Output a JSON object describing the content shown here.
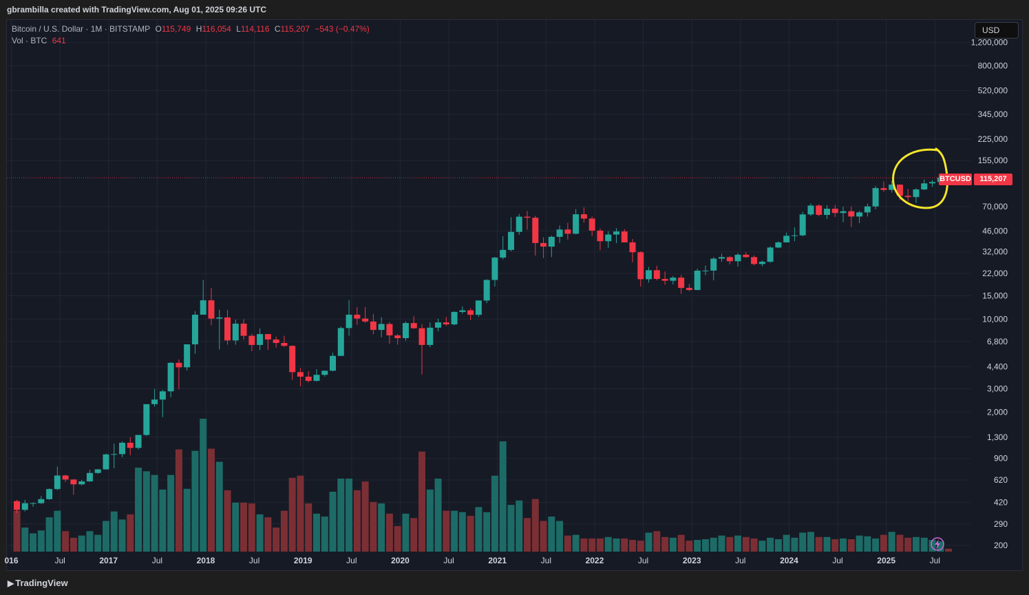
{
  "attribution": "gbrambilla created with TradingView.com, Aug 01, 2025 09:26 UTC",
  "legend": {
    "symbol": "Bitcoin / U.S. Dollar · 1M · BITSTAMP",
    "o_label": "O",
    "o_value": "115,749",
    "h_label": "H",
    "h_value": "116,054",
    "l_label": "L",
    "l_value": "114,116",
    "c_label": "C",
    "c_value": "115,207",
    "change": "−543 (−0.47%)",
    "vol_label": "Vol · BTC",
    "vol_value": "641"
  },
  "currency_button": "USD",
  "price_label": {
    "symbol": "BTCUSD",
    "value": "115,207"
  },
  "footer_brand": "TradingView",
  "colors": {
    "up": "#26a69a",
    "down": "#f23645",
    "vol_up": "#1d6b66",
    "vol_down": "#7b2f34",
    "annotation": "#f5e52a",
    "background": "#161a25"
  },
  "chart_data": {
    "type": "candlestick",
    "title": "Bitcoin / U.S. Dollar · 1M · BITSTAMP",
    "y_scale": "log",
    "y_ticks": [
      200,
      290,
      420,
      620,
      900,
      1300,
      2000,
      3000,
      4400,
      6800,
      10000,
      15000,
      22000,
      32000,
      46000,
      70000,
      155000,
      225000,
      345000,
      520000,
      800000,
      1200000
    ],
    "y_tick_labels": [
      "200",
      "290",
      "420",
      "620",
      "900",
      "1,300",
      "2,000",
      "3,000",
      "4,400",
      "6,800",
      "10,000",
      "15,000",
      "22,000",
      "32,000",
      "46,000",
      "70,000",
      "155,000",
      "225,000",
      "345,000",
      "520,000",
      "800,000",
      "1,200,000"
    ],
    "x_tick_labels": [
      "016",
      "Jul",
      "2017",
      "Jul",
      "2018",
      "Jul",
      "2019",
      "Jul",
      "2020",
      "Jul",
      "2021",
      "Jul",
      "2022",
      "Jul",
      "2023",
      "Jul",
      "2024",
      "Jul",
      "2025",
      "Jul"
    ],
    "x_tick_months": [
      0,
      6,
      12,
      18,
      24,
      30,
      36,
      42,
      48,
      54,
      60,
      66,
      72,
      78,
      84,
      90,
      96,
      102,
      108,
      114
    ],
    "first_month": "2016-01",
    "last_close_line": 115207,
    "candles": [
      [
        430,
        440,
        350,
        370
      ],
      [
        370,
        440,
        360,
        415
      ],
      [
        415,
        420,
        390,
        415
      ],
      [
        415,
        470,
        410,
        445
      ],
      [
        445,
        535,
        440,
        530
      ],
      [
        530,
        780,
        520,
        670
      ],
      [
        670,
        680,
        600,
        625
      ],
      [
        625,
        630,
        480,
        575
      ],
      [
        575,
        620,
        565,
        605
      ],
      [
        605,
        740,
        600,
        700
      ],
      [
        700,
        750,
        690,
        745
      ],
      [
        745,
        980,
        740,
        965
      ],
      [
        965,
        1160,
        760,
        970
      ],
      [
        970,
        1210,
        920,
        1180
      ],
      [
        1180,
        1300,
        950,
        1080
      ],
      [
        1080,
        1350,
        1050,
        1350
      ],
      [
        1350,
        2000,
        1330,
        2300
      ],
      [
        2300,
        2990,
        2200,
        2490
      ],
      [
        2490,
        2950,
        1840,
        2870
      ],
      [
        2870,
        4750,
        2600,
        4700
      ],
      [
        4700,
        4980,
        2980,
        4350
      ],
      [
        4350,
        6470,
        4120,
        6470
      ],
      [
        6470,
        11500,
        5500,
        10800
      ],
      [
        10800,
        19666,
        10800,
        13850
      ],
      [
        13850,
        17200,
        9000,
        10100
      ],
      [
        10100,
        11780,
        5920,
        10300
      ],
      [
        10300,
        11700,
        6425,
        6920
      ],
      [
        6920,
        9900,
        6430,
        9250
      ],
      [
        9250,
        10000,
        7010,
        7500
      ],
      [
        7500,
        7770,
        5750,
        6400
      ],
      [
        6400,
        8500,
        5860,
        7730
      ],
      [
        7730,
        7700,
        5880,
        7030
      ],
      [
        7030,
        7400,
        6100,
        6625
      ],
      [
        6625,
        7500,
        6200,
        6300
      ],
      [
        6300,
        6350,
        3500,
        4000
      ],
      [
        4000,
        4300,
        3130,
        3700
      ],
      [
        3700,
        4060,
        3350,
        3440
      ],
      [
        3440,
        4210,
        3400,
        3820
      ],
      [
        3820,
        4100,
        3700,
        4100
      ],
      [
        4100,
        5600,
        4050,
        5300
      ],
      [
        5300,
        8800,
        5300,
        8570
      ],
      [
        8570,
        13880,
        7500,
        10800
      ],
      [
        10800,
        12300,
        9070,
        10100
      ],
      [
        10100,
        12330,
        9350,
        9600
      ],
      [
        9600,
        10950,
        7700,
        8300
      ],
      [
        8300,
        10350,
        7300,
        9200
      ],
      [
        9200,
        9500,
        6550,
        7550
      ],
      [
        7550,
        7750,
        6430,
        7200
      ],
      [
        7200,
        9600,
        6900,
        9350
      ],
      [
        9350,
        10500,
        8450,
        8550
      ],
      [
        8550,
        9200,
        3850,
        6400
      ],
      [
        6400,
        9450,
        6150,
        8630
      ],
      [
        8630,
        10070,
        8100,
        9450
      ],
      [
        9450,
        10400,
        8900,
        9140
      ],
      [
        9140,
        11440,
        8970,
        11330
      ],
      [
        11330,
        12450,
        10970,
        11650
      ],
      [
        11650,
        12070,
        9830,
        10780
      ],
      [
        10780,
        13860,
        10380,
        13800
      ],
      [
        13800,
        19900,
        13200,
        19700
      ],
      [
        19700,
        29300,
        17600,
        28990
      ],
      [
        28990,
        41950,
        28100,
        33100
      ],
      [
        33100,
        58300,
        32300,
        45200
      ],
      [
        45200,
        61780,
        43000,
        58800
      ],
      [
        58800,
        64900,
        47000,
        57750
      ],
      [
        57750,
        59600,
        30000,
        37300
      ],
      [
        37300,
        41300,
        28800,
        35050
      ],
      [
        35050,
        42400,
        29300,
        41500
      ],
      [
        41500,
        50500,
        37400,
        47100
      ],
      [
        47100,
        52900,
        39600,
        43800
      ],
      [
        43800,
        67000,
        43300,
        61300
      ],
      [
        61300,
        69000,
        53000,
        56900
      ],
      [
        56900,
        59000,
        42000,
        46200
      ],
      [
        46200,
        47950,
        32950,
        38480
      ],
      [
        38480,
        45800,
        34300,
        43180
      ],
      [
        43180,
        48200,
        37200,
        45530
      ],
      [
        45530,
        47450,
        37700,
        37700
      ],
      [
        37700,
        40000,
        26700,
        31800
      ],
      [
        31800,
        32400,
        17570,
        19950
      ],
      [
        19950,
        24670,
        18800,
        23300
      ],
      [
        23300,
        25200,
        19550,
        20050
      ],
      [
        20050,
        22800,
        18150,
        19430
      ],
      [
        19430,
        21100,
        18200,
        20500
      ],
      [
        20500,
        21450,
        15500,
        17160
      ],
      [
        17160,
        18400,
        16250,
        16550
      ],
      [
        16550,
        23950,
        16500,
        23130
      ],
      [
        23130,
        25250,
        21400,
        23150
      ],
      [
        23150,
        29200,
        19550,
        28480
      ],
      [
        28480,
        31000,
        26950,
        29230
      ],
      [
        29230,
        29850,
        25800,
        27220
      ],
      [
        27220,
        31400,
        24800,
        30470
      ],
      [
        30470,
        31860,
        28860,
        29230
      ],
      [
        29230,
        30050,
        25400,
        25940
      ],
      [
        25940,
        27500,
        24920,
        26970
      ],
      [
        26970,
        35200,
        26540,
        34500
      ],
      [
        34500,
        38450,
        34100,
        37720
      ],
      [
        37720,
        44700,
        37600,
        42280
      ],
      [
        42280,
        48970,
        38550,
        42580
      ],
      [
        42580,
        63900,
        41880,
        61130
      ],
      [
        61130,
        73800,
        59300,
        71300
      ],
      [
        71300,
        72800,
        59200,
        60660
      ],
      [
        60660,
        71900,
        56500,
        67500
      ],
      [
        67500,
        72000,
        58500,
        62670
      ],
      [
        62670,
        70000,
        53500,
        64600
      ],
      [
        64600,
        70100,
        49100,
        58970
      ],
      [
        58970,
        65000,
        52600,
        63330
      ],
      [
        63330,
        73600,
        58900,
        70200
      ],
      [
        70200,
        99800,
        66800,
        96400
      ],
      [
        96400,
        108300,
        90500,
        93400
      ],
      [
        93400,
        109350,
        89200,
        102400
      ],
      [
        102400,
        102500,
        78200,
        84350
      ],
      [
        84350,
        95000,
        76600,
        82550
      ],
      [
        82550,
        95800,
        74500,
        94200
      ],
      [
        94200,
        111900,
        93000,
        104600
      ],
      [
        104600,
        110600,
        98200,
        107100
      ],
      [
        107100,
        123200,
        105100,
        115749
      ],
      [
        115749,
        116054,
        114116,
        115207
      ]
    ],
    "volume": [
      560,
      330,
      250,
      290,
      470,
      560,
      280,
      190,
      220,
      280,
      230,
      420,
      550,
      440,
      510,
      1150,
      1100,
      1050,
      850,
      1050,
      1400,
      860,
      1380,
      1820,
      1410,
      1230,
      840,
      670,
      670,
      660,
      510,
      470,
      330,
      560,
      1010,
      1040,
      660,
      520,
      480,
      820,
      1000,
      1000,
      840,
      960,
      680,
      660,
      520,
      350,
      520,
      460,
      1370,
      850,
      1000,
      560,
      560,
      540,
      490,
      610,
      540,
      1040,
      1510,
      640,
      700,
      460,
      720,
      420,
      480,
      420,
      220,
      230,
      180,
      180,
      180,
      200,
      180,
      180,
      160,
      150,
      260,
      280,
      200,
      190,
      230,
      150,
      160,
      170,
      190,
      220,
      200,
      220,
      200,
      180,
      150,
      190,
      170,
      230,
      190,
      260,
      270,
      200,
      200,
      170,
      180,
      170,
      220,
      210,
      180,
      230,
      270,
      230,
      190,
      200,
      190,
      160,
      140,
      40
    ],
    "volume_tick_labels_note": ""
  }
}
